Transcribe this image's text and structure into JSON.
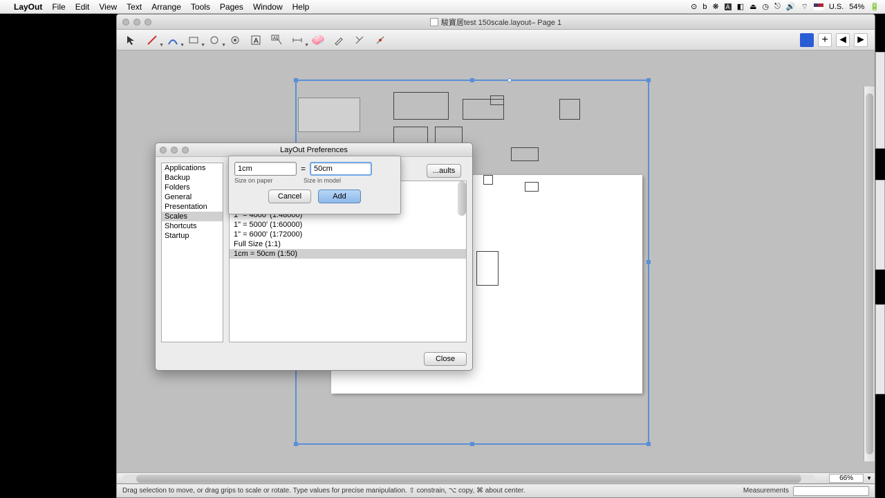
{
  "menubar": {
    "app_name": "LayOut",
    "items": [
      "File",
      "Edit",
      "View",
      "Text",
      "Arrange",
      "Tools",
      "Pages",
      "Window",
      "Help"
    ],
    "right": {
      "input_lang": "U.S.",
      "battery": "54%"
    }
  },
  "document": {
    "title": "駿寶居test 150scale.layout– Page 1",
    "zoom": "66%",
    "status_hint": "Drag selection to move, or drag grips to scale or rotate. Type values for precise manipulation. ⇧ constrain, ⌥ copy, ⌘ about center.",
    "measurements_label": "Measurements"
  },
  "prefs": {
    "title": "LayOut Preferences",
    "categories": [
      "Applications",
      "Backup",
      "Folders",
      "General",
      "Presentation",
      "Scales",
      "Shortcuts",
      "Startup"
    ],
    "selected_category": "Scales",
    "defaults_button": "...aults",
    "scales": [
      "1\" = 4000' (1:48000)",
      "1\" = 5000' (1:60000)",
      "1\" = 6000' (1:72000)",
      "Full Size (1:1)",
      "1cm = 50cm (1:50)"
    ],
    "selected_scale": "1cm = 50cm (1:50)",
    "close_label": "Close"
  },
  "addscale": {
    "paper_value": "1cm",
    "model_value": "50cm",
    "paper_label": "Size on paper",
    "model_label": "Size in model",
    "cancel": "Cancel",
    "add": "Add"
  }
}
